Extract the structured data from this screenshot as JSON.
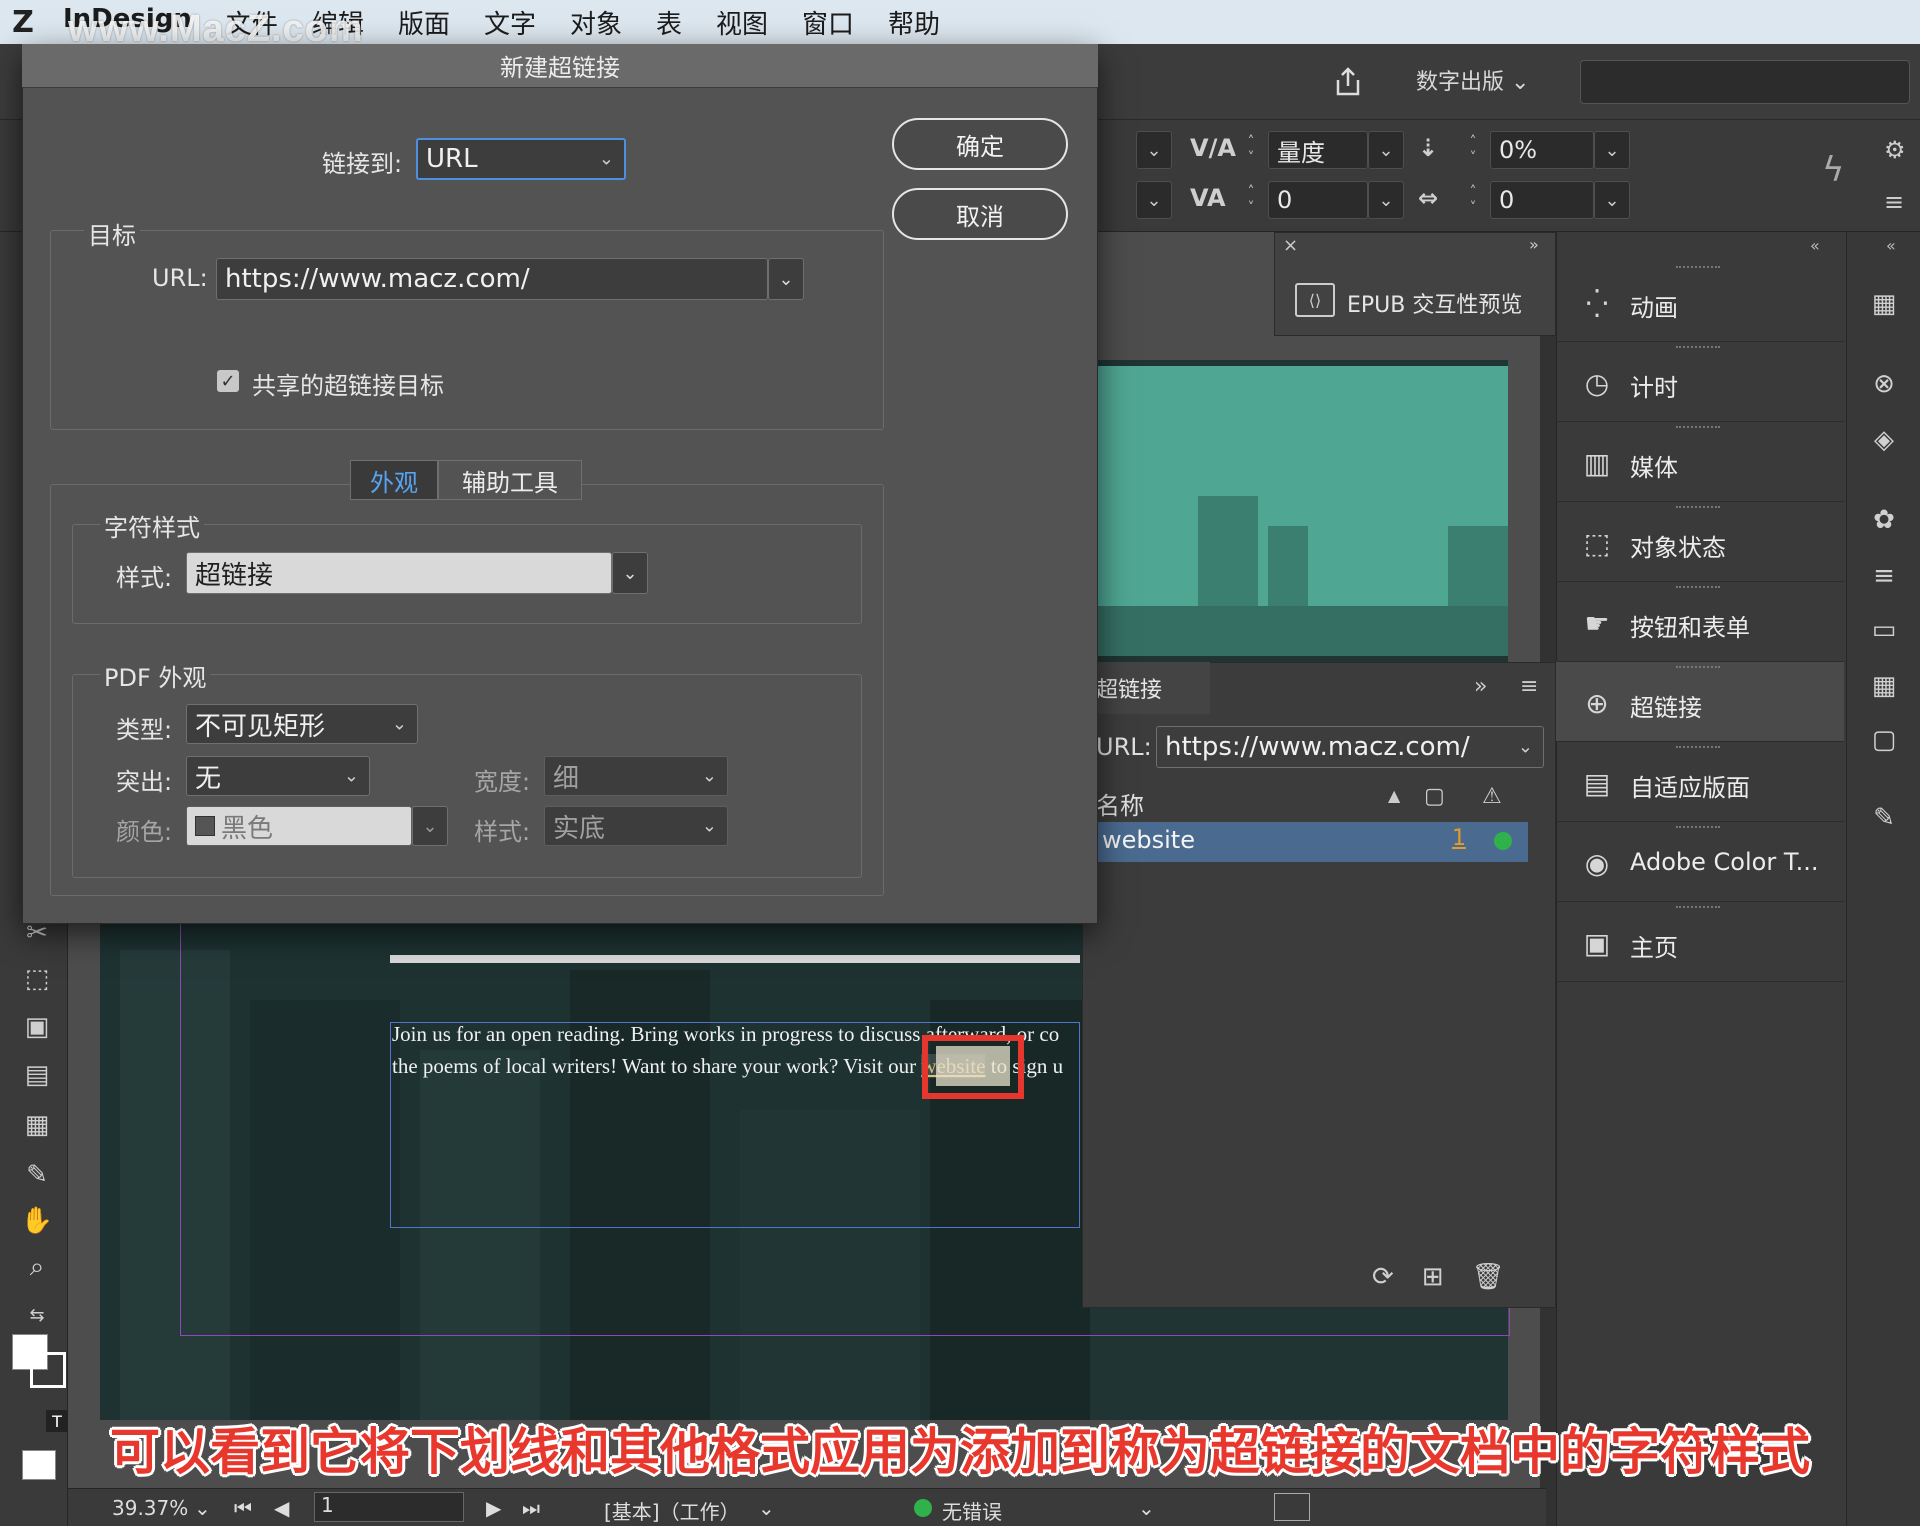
{
  "menubar": {
    "watermark": "www.MacZ.com",
    "items": [
      "InDesign",
      "文件",
      "编辑",
      "版面",
      "文字",
      "对象",
      "表",
      "视图",
      "窗口",
      "帮助"
    ]
  },
  "appbar": {
    "workspace": "数字出版"
  },
  "controlbar": {
    "kerning_method": "量度",
    "tracking_value": "0%",
    "kerning_value": "0",
    "baseline_value": "0"
  },
  "dialog": {
    "title": "新建超链接",
    "link_to_label": "链接到:",
    "link_to_value": "URL",
    "ok_label": "确定",
    "cancel_label": "取消",
    "target_group": "目标",
    "url_label": "URL:",
    "url_value": "https://www.macz.com/",
    "shared_label": "共享的超链接目标",
    "tabs": [
      "外观",
      "辅助工具"
    ],
    "char_style_group": "字符样式",
    "style_label": "样式:",
    "style_value": "超链接",
    "pdf_group": "PDF 外观",
    "type_label": "类型:",
    "type_value": "不可见矩形",
    "highlight_label": "突出:",
    "highlight_value": "无",
    "width_label": "宽度:",
    "width_value": "细",
    "color_label": "颜色:",
    "color_value": "黑色",
    "linestyle_label": "样式:",
    "linestyle_value": "实底"
  },
  "document": {
    "line1": "Join us for an open reading. Bring works in progress to discuss afterward, or co",
    "line2_pre": "the poems of local writers! Want to share your work? Visit our ",
    "line2_link": "website",
    "line2_post": " to sign u"
  },
  "epub_panel": {
    "label": "EPUB 交互性预览"
  },
  "hyperlinks_panel": {
    "tab": "超链接",
    "url_label": "URL:",
    "url_value": "https://www.macz.com/",
    "col_name": "名称",
    "row_name": "website",
    "row_page": "1"
  },
  "right_panel": {
    "items": [
      "动画",
      "计时",
      "媒体",
      "对象状态",
      "按钮和表单",
      "超链接",
      "自适应版面",
      "Adobe Color T...",
      "主页"
    ],
    "active": "超链接"
  },
  "statusbar": {
    "zoom": "39.37%",
    "page": "1",
    "profile": "[基本]（工作）",
    "preflight": "无错误"
  },
  "caption": "可以看到它将下划线和其他格式应用为添加到称为超链接的文档中的字符样式"
}
